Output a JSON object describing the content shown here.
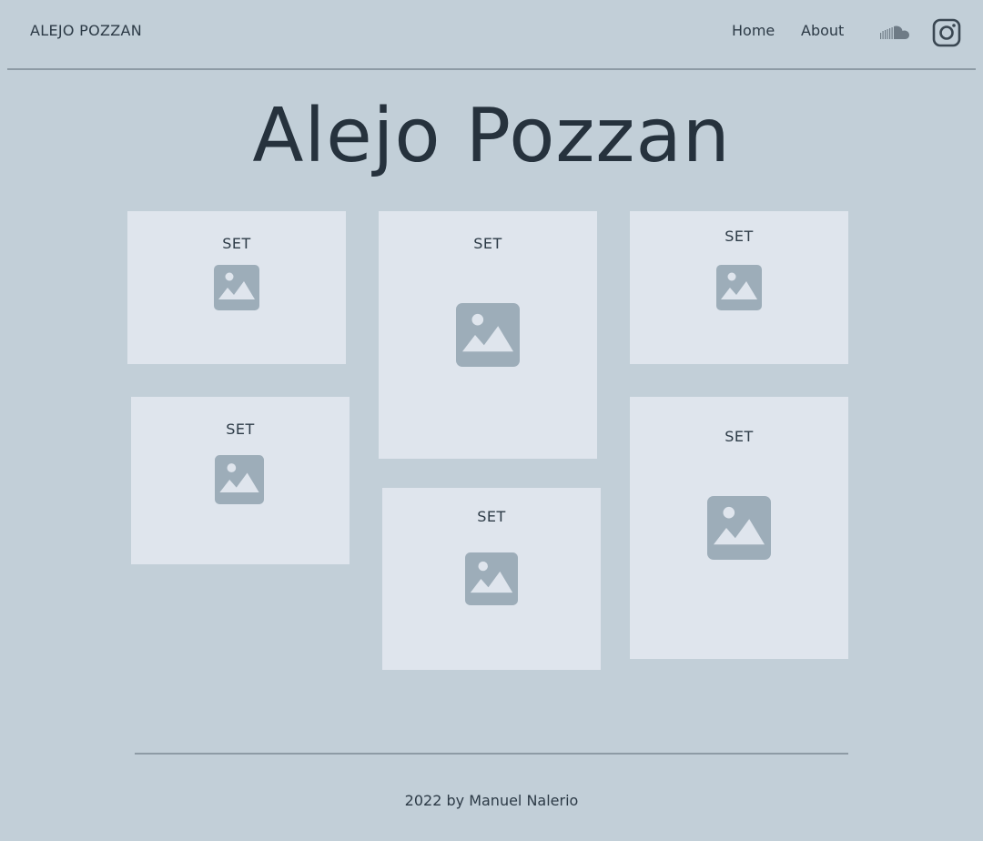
{
  "header": {
    "logo": "ALEJO POZZAN",
    "nav": {
      "home": "Home",
      "about": "About"
    },
    "social": [
      "soundcloud-icon",
      "instagram-icon"
    ]
  },
  "main": {
    "title": "Alejo Pozzan",
    "cards": [
      {
        "label": "SET",
        "icon": "image-placeholder-icon"
      },
      {
        "label": "SET",
        "icon": "image-placeholder-icon"
      },
      {
        "label": "SET",
        "icon": "image-placeholder-icon"
      },
      {
        "label": "SET",
        "icon": "image-placeholder-icon"
      },
      {
        "label": "SET",
        "icon": "image-placeholder-icon"
      },
      {
        "label": "SET",
        "icon": "image-placeholder-icon"
      }
    ]
  },
  "footer": {
    "text": "2022 by Manuel Nalerio"
  },
  "colors": {
    "background": "#c2cfd8",
    "card": "#dfe5ed",
    "icon": "#9dadb9",
    "text": "#26323d"
  }
}
